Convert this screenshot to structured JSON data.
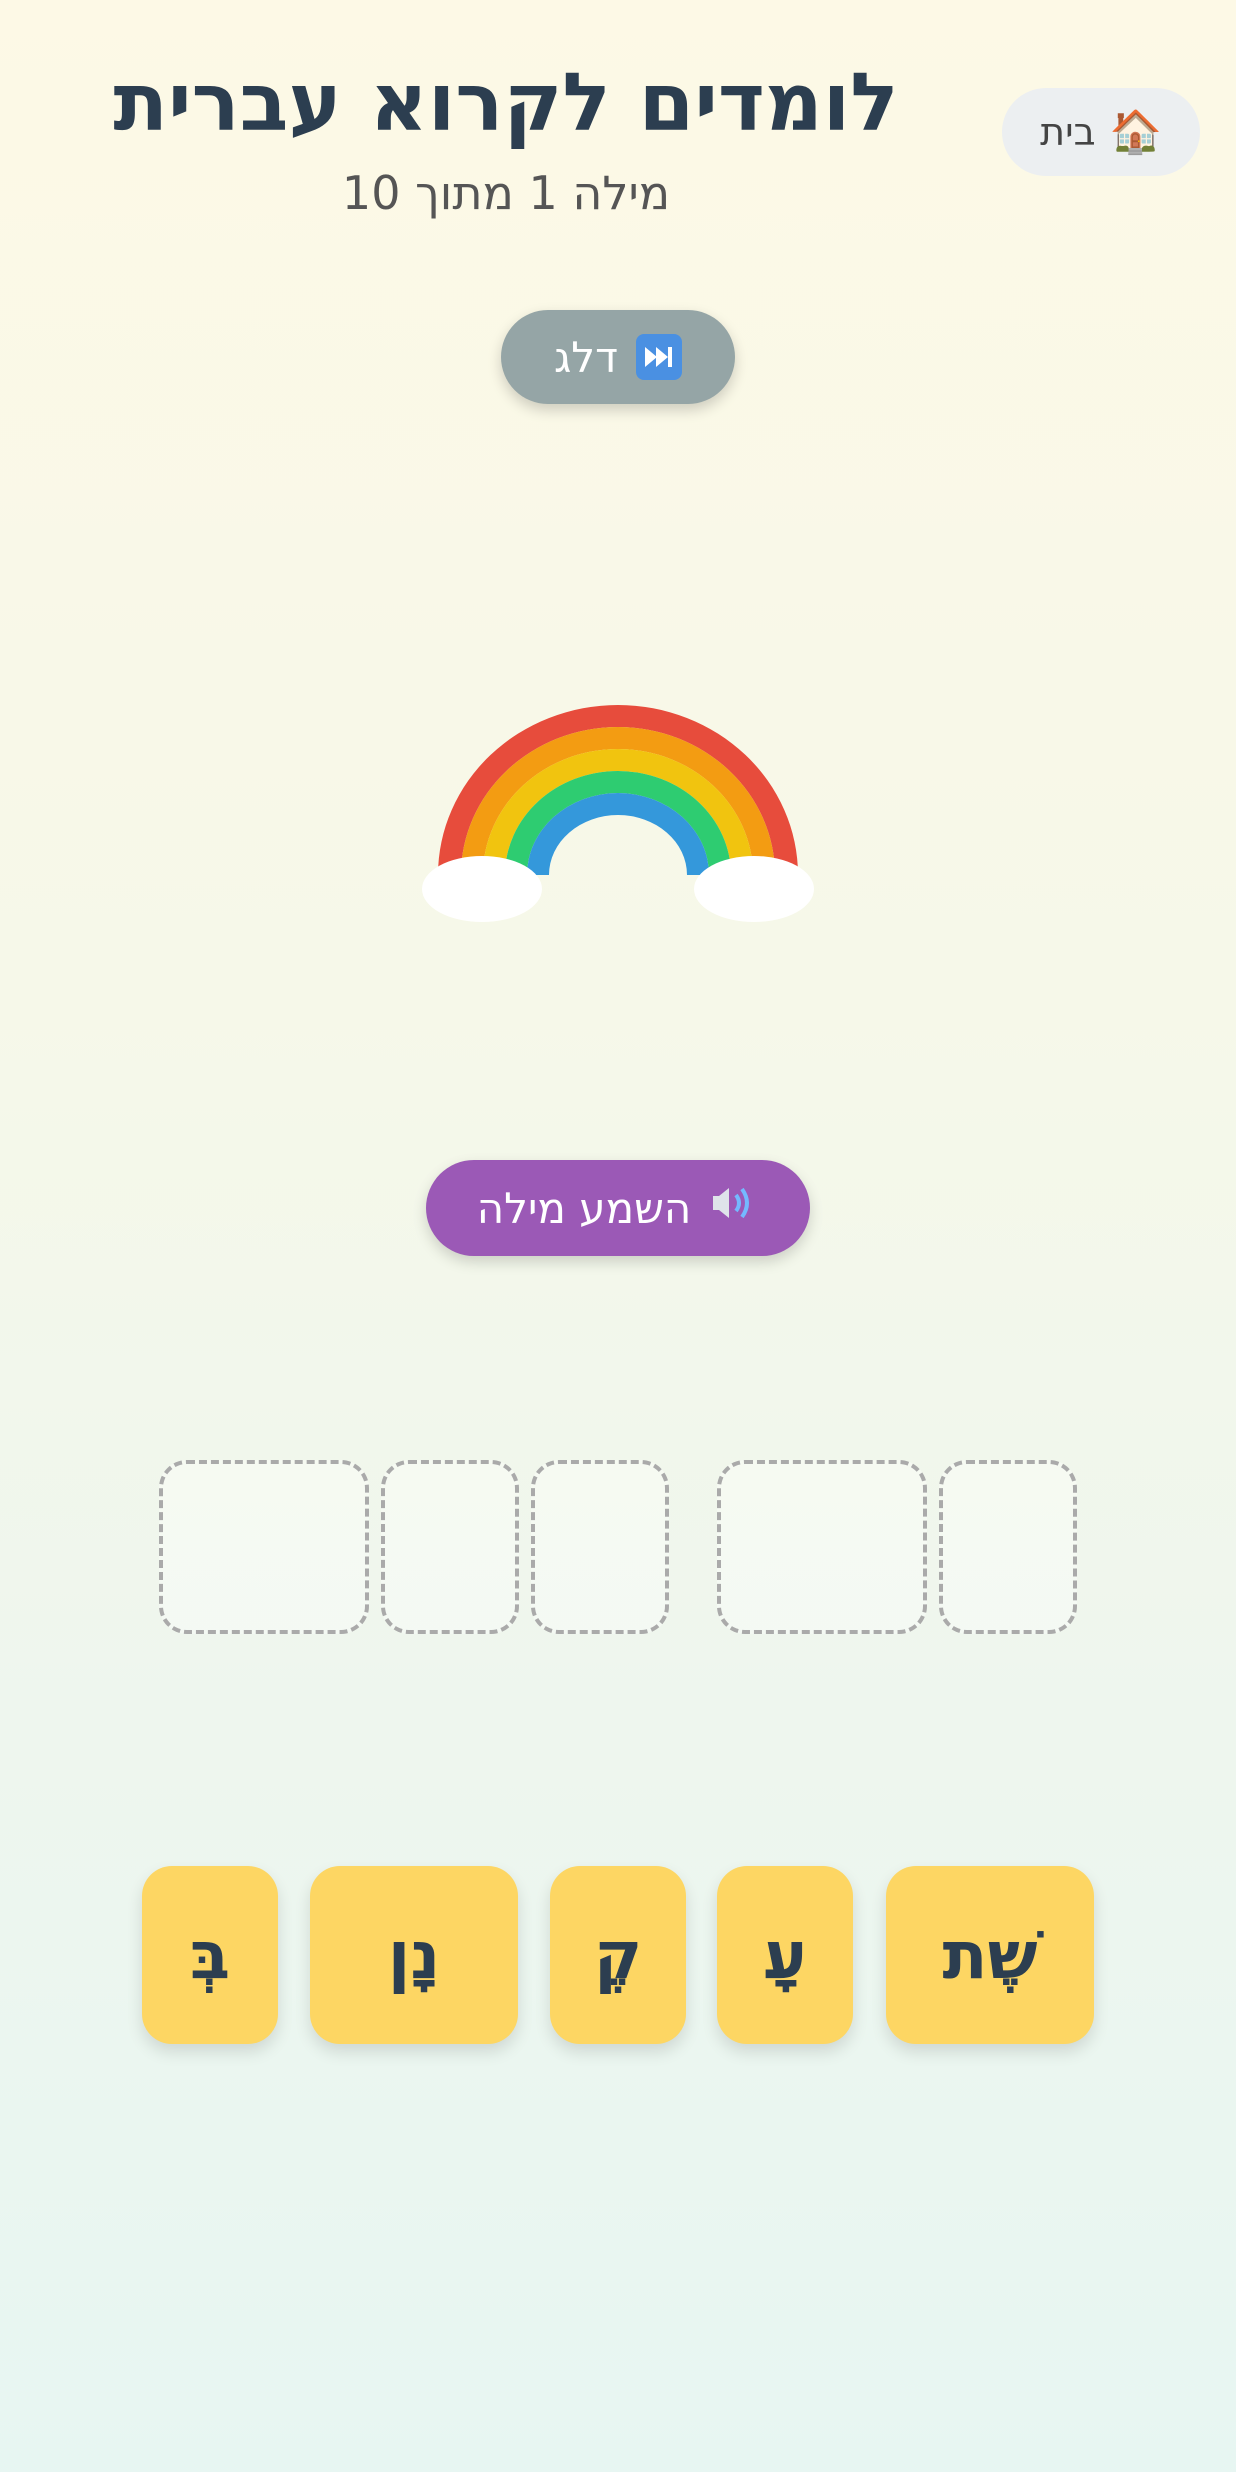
{
  "header": {
    "title": "לומדים לקרוא עברית",
    "progress_text": "מילה 1 מתוך 10",
    "home_label": "בית",
    "home_icon": "🏠"
  },
  "controls": {
    "skip_label": "דלג",
    "skip_icon": "fast-forward-icon",
    "speak_label": "השמע מילה",
    "speak_icon": "speaker-icon"
  },
  "picture": {
    "name": "rainbow",
    "colors": [
      "#e74c3c",
      "#f39c12",
      "#f1c40f",
      "#2ecc71",
      "#3498db"
    ]
  },
  "answer_slots": [
    {
      "id": 1,
      "size": "wide"
    },
    {
      "id": 2,
      "size": "narrow"
    },
    {
      "id": 3,
      "size": "narrow"
    },
    {
      "id": 4,
      "size": "wide"
    },
    {
      "id": 5,
      "size": "narrow"
    }
  ],
  "letter_tiles": [
    "שֶׁת",
    "עָ",
    "קֶ",
    "נָן",
    "בְּ"
  ],
  "colors": {
    "title": "#2c3e50",
    "skip_button": "#95a5a6",
    "speak_button": "#9b59b6",
    "tile": "#fdd663",
    "slot_border": "#aaaaaa",
    "home_button": "#eceff1"
  }
}
